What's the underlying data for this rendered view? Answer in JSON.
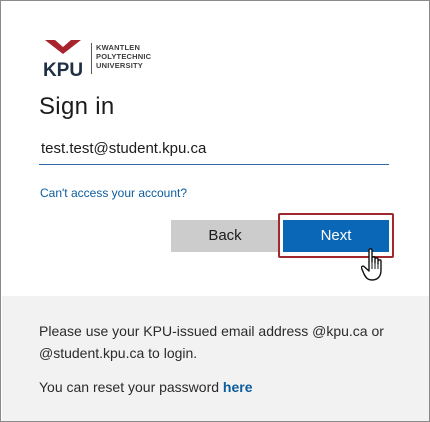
{
  "brand": {
    "logo_text": "KPU",
    "university_lines": [
      "KWANTLEN",
      "POLYTECHNIC",
      "UNIVERSITY"
    ]
  },
  "signin": {
    "title": "Sign in",
    "email_value": "test.test@student.kpu.ca",
    "cant_access_link": "Can't access your account?",
    "back_label": "Back",
    "next_label": "Next"
  },
  "footer": {
    "info_text": "Please use your KPU-issued email address @kpu.ca or @student.kpu.ca to login.",
    "reset_prefix": "You can reset your password ",
    "reset_link": "here"
  },
  "colors": {
    "accent": "#0a67b8",
    "link": "#0b5c9e",
    "highlight_border": "#a0292e",
    "brand_red": "#a7232e",
    "footer_bg": "#f2f2f2"
  },
  "icons": [
    "kpu-logo-icon",
    "hand-cursor-icon"
  ]
}
